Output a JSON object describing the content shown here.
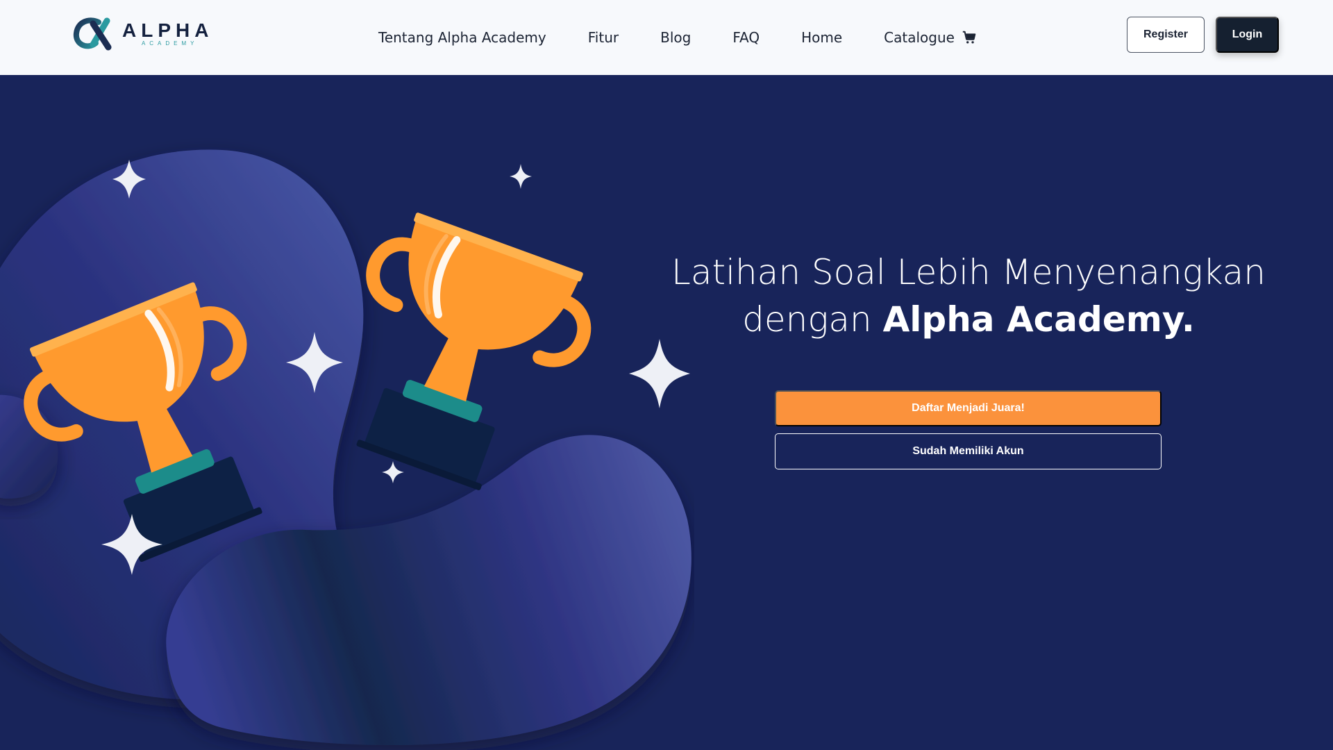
{
  "brand": {
    "logo_title": "ALPHA",
    "logo_subtitle": "ACADEMY",
    "logo_icon": "alpha-logo-icon"
  },
  "nav": {
    "links": [
      {
        "label": "Tentang Alpha Academy"
      },
      {
        "label": "Fitur"
      },
      {
        "label": "Blog"
      },
      {
        "label": "FAQ"
      },
      {
        "label": "Home"
      },
      {
        "label": "Catalogue",
        "icon": "shopping-cart-icon"
      }
    ],
    "register_label": "Register",
    "login_label": "Login"
  },
  "hero": {
    "heading_line1": "Latihan Soal Lebih Menyenangkan",
    "heading_line2_prefix": "dengan ",
    "heading_line2_bold": "Alpha Academy.",
    "primary_button": "Daftar Menjadi Juara!",
    "secondary_button": "Sudah Memiliki Akun",
    "illustration_icons": [
      "trophy-icon",
      "trophy-icon",
      "sparkle-icon"
    ]
  },
  "colors": {
    "navbar_bg": "#f7f9fc",
    "hero_bg": "#18245a",
    "accent_orange": "#fb923c",
    "login_bg": "#152030",
    "trophy_orange": "#ff9a2e",
    "trophy_teal": "#1c8c8a",
    "trophy_base": "#0d2145"
  }
}
